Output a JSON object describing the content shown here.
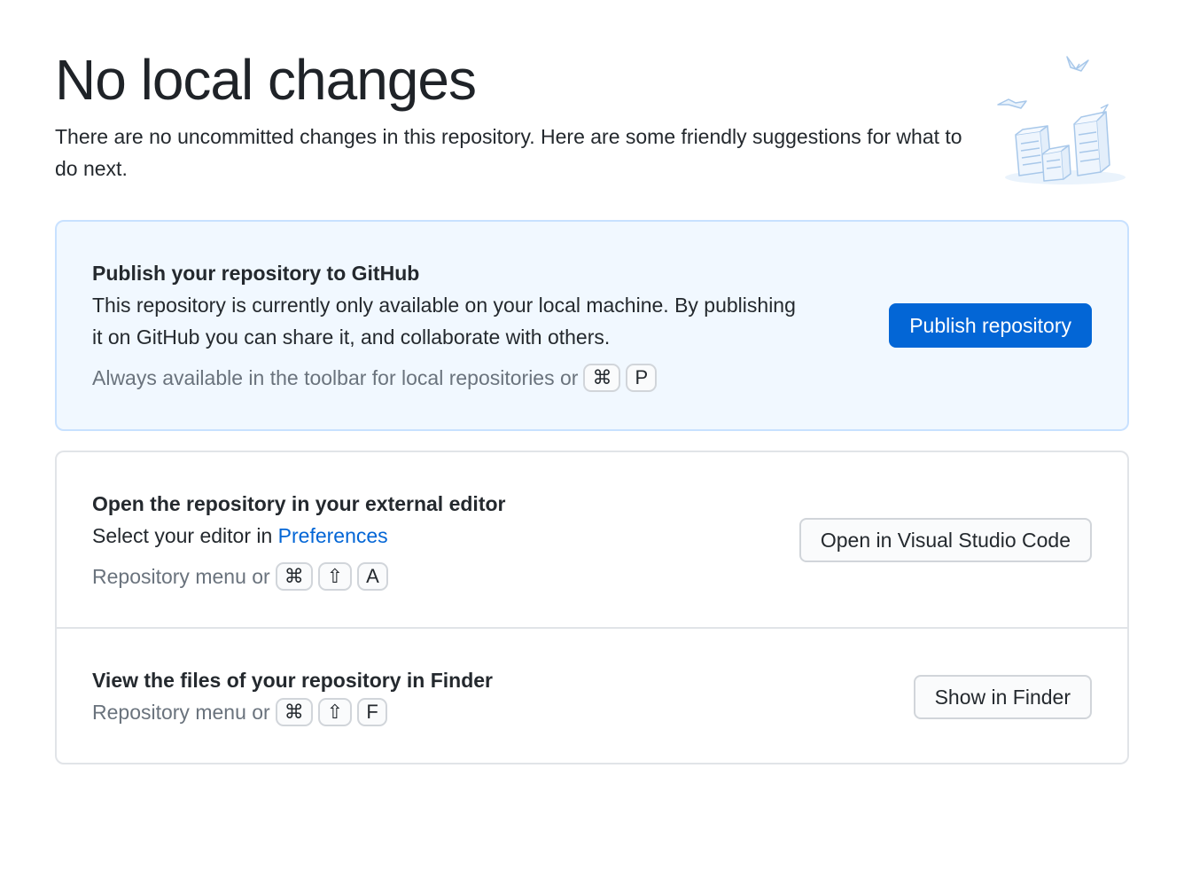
{
  "header": {
    "title": "No local changes",
    "subtitle": "There are no uncommitted changes in this repository. Here are some friendly suggestions for what to do next."
  },
  "publish": {
    "title": "Publish your repository to GitHub",
    "description": "This repository is currently only available on your local machine. By publishing it on GitHub you can share it, and collaborate with others.",
    "hint": "Always available in the toolbar for local repositories or",
    "keys": [
      "⌘",
      "P"
    ],
    "button_label": "Publish repository"
  },
  "editor": {
    "title": "Open the repository in your external editor",
    "description_prefix": "Select your editor in",
    "description_link": "Preferences",
    "hint": "Repository menu or",
    "keys": [
      "⌘",
      "⇧",
      "A"
    ],
    "button_label": "Open in Visual Studio Code"
  },
  "finder": {
    "title": "View the files of your repository in Finder",
    "hint": "Repository menu or",
    "keys": [
      "⌘",
      "⇧",
      "F"
    ],
    "button_label": "Show in Finder"
  },
  "colors": {
    "accent": "#0366d6",
    "highlight_bg": "#f1f8ff",
    "highlight_border": "#c8e1ff",
    "muted_text": "#6a737d"
  },
  "icons": {
    "illustration": "paper-stack-illustration"
  }
}
